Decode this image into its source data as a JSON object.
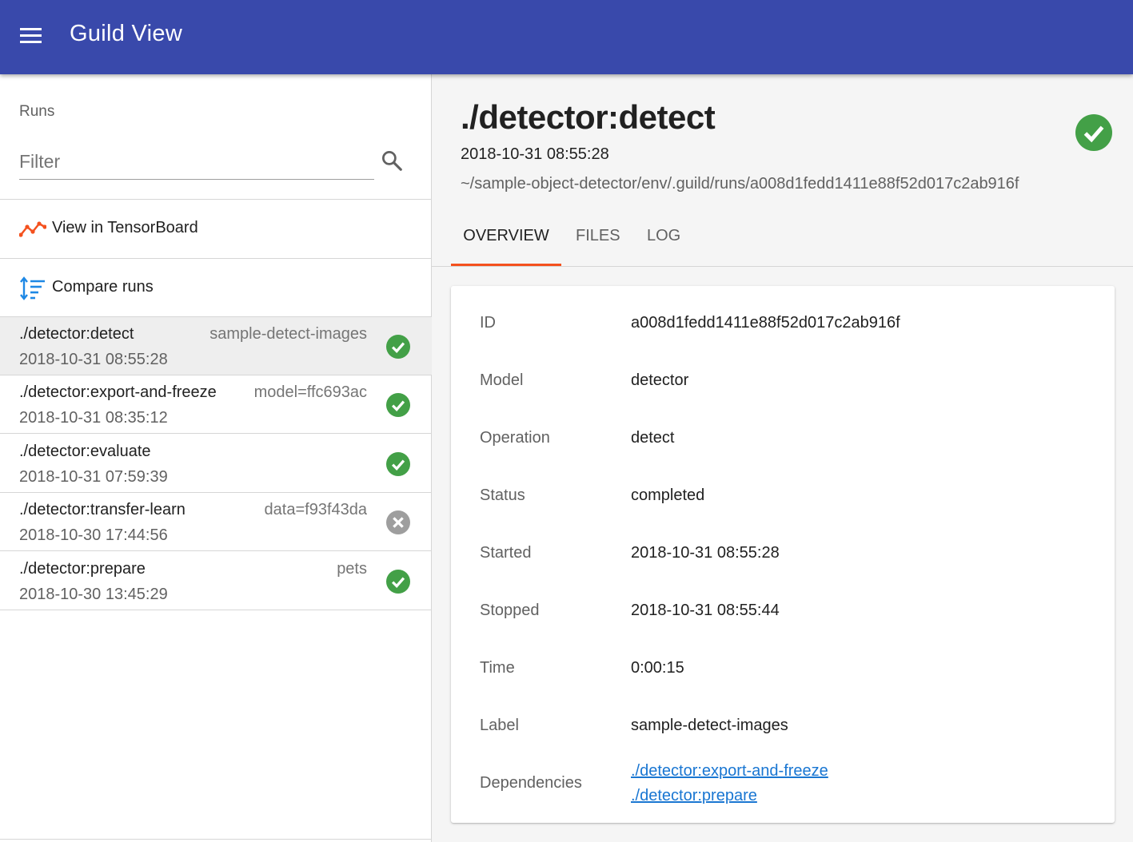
{
  "app": {
    "title": "Guild View",
    "accent": "#3949ab"
  },
  "sidebar": {
    "runs_label": "Runs",
    "filter_placeholder": "Filter",
    "actions": [
      {
        "label": "View in TensorBoard",
        "icon": "tensorboard-icon"
      },
      {
        "label": "Compare runs",
        "icon": "compare-icon"
      }
    ],
    "runs": [
      {
        "name": "./detector:detect",
        "tag": "sample-detect-images",
        "date": "2018-10-31 08:55:28",
        "status": "completed",
        "selected": true
      },
      {
        "name": "./detector:export-and-freeze",
        "tag": "model=ffc693ac",
        "date": "2018-10-31 08:35:12",
        "status": "completed",
        "selected": false
      },
      {
        "name": "./detector:evaluate",
        "tag": "",
        "date": "2018-10-31 07:59:39",
        "status": "completed",
        "selected": false
      },
      {
        "name": "./detector:transfer-learn",
        "tag": "data=f93f43da",
        "date": "2018-10-30 17:44:56",
        "status": "error",
        "selected": false
      },
      {
        "name": "./detector:prepare",
        "tag": "pets",
        "date": "2018-10-30 13:45:29",
        "status": "completed",
        "selected": false
      }
    ]
  },
  "main": {
    "title": "./detector:detect",
    "date": "2018-10-31 08:55:28",
    "path": "~/sample-object-detector/env/.guild/runs/a008d1fedd1411e88f52d017c2ab916f",
    "tabs": [
      "OVERVIEW",
      "FILES",
      "LOG"
    ],
    "active_tab": "OVERVIEW",
    "overview": [
      {
        "key": "ID",
        "value": "a008d1fedd1411e88f52d017c2ab916f"
      },
      {
        "key": "Model",
        "value": "detector"
      },
      {
        "key": "Operation",
        "value": "detect"
      },
      {
        "key": "Status",
        "value": "completed"
      },
      {
        "key": "Started",
        "value": "2018-10-31 08:55:28"
      },
      {
        "key": "Stopped",
        "value": "2018-10-31 08:55:44"
      },
      {
        "key": "Time",
        "value": "0:00:15"
      },
      {
        "key": "Label",
        "value": "sample-detect-images"
      }
    ],
    "dependencies_label": "Dependencies",
    "dependencies": [
      "./detector:export-and-freeze",
      "./detector:prepare"
    ]
  },
  "colors": {
    "success": "#43a047",
    "error": "#9e9e9e",
    "tab_indicator": "#f4511e",
    "link": "#1976d2"
  }
}
